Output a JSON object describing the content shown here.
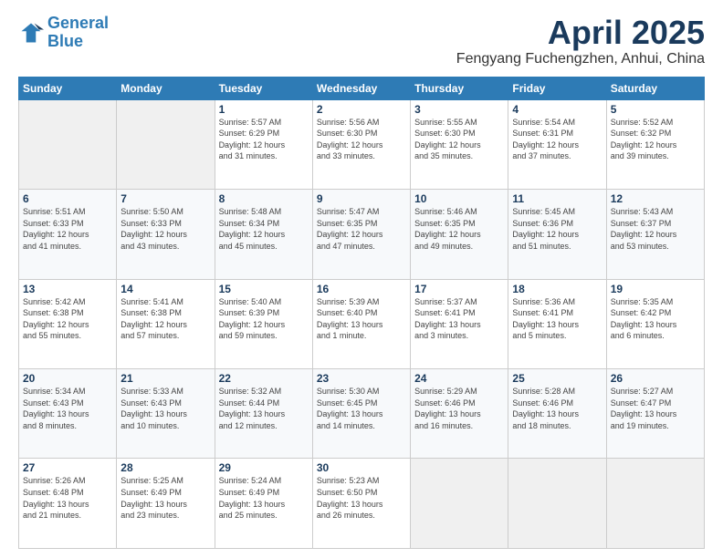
{
  "header": {
    "logo_line1": "General",
    "logo_line2": "Blue",
    "title": "April 2025",
    "subtitle": "Fengyang Fuchengzhen, Anhui, China"
  },
  "days_of_week": [
    "Sunday",
    "Monday",
    "Tuesday",
    "Wednesday",
    "Thursday",
    "Friday",
    "Saturday"
  ],
  "weeks": [
    [
      {
        "day": "",
        "info": ""
      },
      {
        "day": "",
        "info": ""
      },
      {
        "day": "1",
        "info": "Sunrise: 5:57 AM\nSunset: 6:29 PM\nDaylight: 12 hours\nand 31 minutes."
      },
      {
        "day": "2",
        "info": "Sunrise: 5:56 AM\nSunset: 6:30 PM\nDaylight: 12 hours\nand 33 minutes."
      },
      {
        "day": "3",
        "info": "Sunrise: 5:55 AM\nSunset: 6:30 PM\nDaylight: 12 hours\nand 35 minutes."
      },
      {
        "day": "4",
        "info": "Sunrise: 5:54 AM\nSunset: 6:31 PM\nDaylight: 12 hours\nand 37 minutes."
      },
      {
        "day": "5",
        "info": "Sunrise: 5:52 AM\nSunset: 6:32 PM\nDaylight: 12 hours\nand 39 minutes."
      }
    ],
    [
      {
        "day": "6",
        "info": "Sunrise: 5:51 AM\nSunset: 6:33 PM\nDaylight: 12 hours\nand 41 minutes."
      },
      {
        "day": "7",
        "info": "Sunrise: 5:50 AM\nSunset: 6:33 PM\nDaylight: 12 hours\nand 43 minutes."
      },
      {
        "day": "8",
        "info": "Sunrise: 5:48 AM\nSunset: 6:34 PM\nDaylight: 12 hours\nand 45 minutes."
      },
      {
        "day": "9",
        "info": "Sunrise: 5:47 AM\nSunset: 6:35 PM\nDaylight: 12 hours\nand 47 minutes."
      },
      {
        "day": "10",
        "info": "Sunrise: 5:46 AM\nSunset: 6:35 PM\nDaylight: 12 hours\nand 49 minutes."
      },
      {
        "day": "11",
        "info": "Sunrise: 5:45 AM\nSunset: 6:36 PM\nDaylight: 12 hours\nand 51 minutes."
      },
      {
        "day": "12",
        "info": "Sunrise: 5:43 AM\nSunset: 6:37 PM\nDaylight: 12 hours\nand 53 minutes."
      }
    ],
    [
      {
        "day": "13",
        "info": "Sunrise: 5:42 AM\nSunset: 6:38 PM\nDaylight: 12 hours\nand 55 minutes."
      },
      {
        "day": "14",
        "info": "Sunrise: 5:41 AM\nSunset: 6:38 PM\nDaylight: 12 hours\nand 57 minutes."
      },
      {
        "day": "15",
        "info": "Sunrise: 5:40 AM\nSunset: 6:39 PM\nDaylight: 12 hours\nand 59 minutes."
      },
      {
        "day": "16",
        "info": "Sunrise: 5:39 AM\nSunset: 6:40 PM\nDaylight: 13 hours\nand 1 minute."
      },
      {
        "day": "17",
        "info": "Sunrise: 5:37 AM\nSunset: 6:41 PM\nDaylight: 13 hours\nand 3 minutes."
      },
      {
        "day": "18",
        "info": "Sunrise: 5:36 AM\nSunset: 6:41 PM\nDaylight: 13 hours\nand 5 minutes."
      },
      {
        "day": "19",
        "info": "Sunrise: 5:35 AM\nSunset: 6:42 PM\nDaylight: 13 hours\nand 6 minutes."
      }
    ],
    [
      {
        "day": "20",
        "info": "Sunrise: 5:34 AM\nSunset: 6:43 PM\nDaylight: 13 hours\nand 8 minutes."
      },
      {
        "day": "21",
        "info": "Sunrise: 5:33 AM\nSunset: 6:43 PM\nDaylight: 13 hours\nand 10 minutes."
      },
      {
        "day": "22",
        "info": "Sunrise: 5:32 AM\nSunset: 6:44 PM\nDaylight: 13 hours\nand 12 minutes."
      },
      {
        "day": "23",
        "info": "Sunrise: 5:30 AM\nSunset: 6:45 PM\nDaylight: 13 hours\nand 14 minutes."
      },
      {
        "day": "24",
        "info": "Sunrise: 5:29 AM\nSunset: 6:46 PM\nDaylight: 13 hours\nand 16 minutes."
      },
      {
        "day": "25",
        "info": "Sunrise: 5:28 AM\nSunset: 6:46 PM\nDaylight: 13 hours\nand 18 minutes."
      },
      {
        "day": "26",
        "info": "Sunrise: 5:27 AM\nSunset: 6:47 PM\nDaylight: 13 hours\nand 19 minutes."
      }
    ],
    [
      {
        "day": "27",
        "info": "Sunrise: 5:26 AM\nSunset: 6:48 PM\nDaylight: 13 hours\nand 21 minutes."
      },
      {
        "day": "28",
        "info": "Sunrise: 5:25 AM\nSunset: 6:49 PM\nDaylight: 13 hours\nand 23 minutes."
      },
      {
        "day": "29",
        "info": "Sunrise: 5:24 AM\nSunset: 6:49 PM\nDaylight: 13 hours\nand 25 minutes."
      },
      {
        "day": "30",
        "info": "Sunrise: 5:23 AM\nSunset: 6:50 PM\nDaylight: 13 hours\nand 26 minutes."
      },
      {
        "day": "",
        "info": ""
      },
      {
        "day": "",
        "info": ""
      },
      {
        "day": "",
        "info": ""
      }
    ]
  ]
}
